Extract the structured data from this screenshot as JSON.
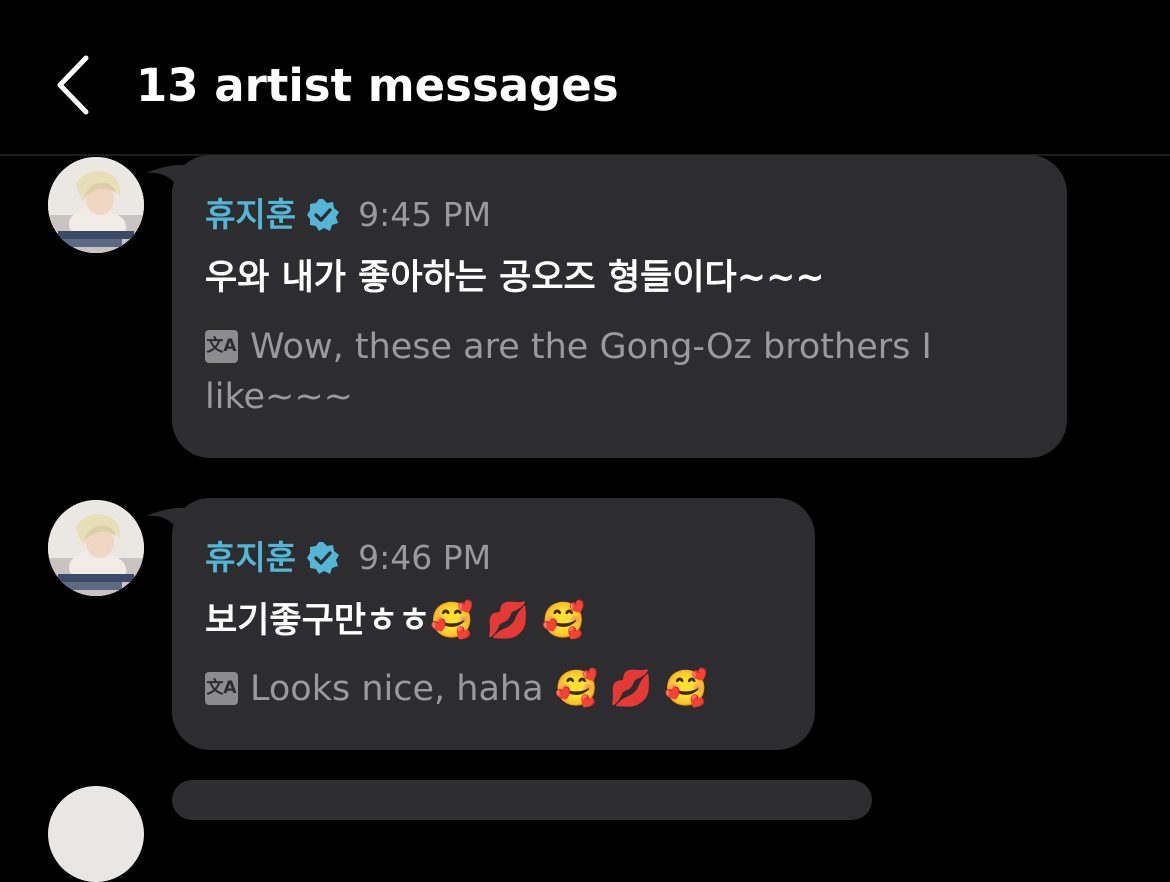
{
  "header": {
    "title": "13 artist messages",
    "back_icon": "chevron-left-icon"
  },
  "messages": [
    {
      "sender": "휴지훈",
      "time": "9:45 PM",
      "text": "우와 내가 좋아하는 공오즈 형들이다~~~",
      "translation_line1": "Wow, these are the Gong-Oz brothers I",
      "translation_line2": "like~~~"
    },
    {
      "sender": "휴지훈",
      "time": "9:46 PM",
      "text": "보기좋구만ㅎㅎ🥰 💋 🥰",
      "translation": "Looks nice, haha 🥰 💋 🥰"
    }
  ],
  "colors": {
    "background": "#000000",
    "bubble": "#2d2d2f",
    "sender": "#53b6d6",
    "verified_badge": "#53b6d6",
    "meta_gray": "#9a9a9e"
  },
  "icons": {
    "verified": "verified-badge-icon",
    "translate": "translate-icon",
    "translate_glyph": "文A"
  }
}
